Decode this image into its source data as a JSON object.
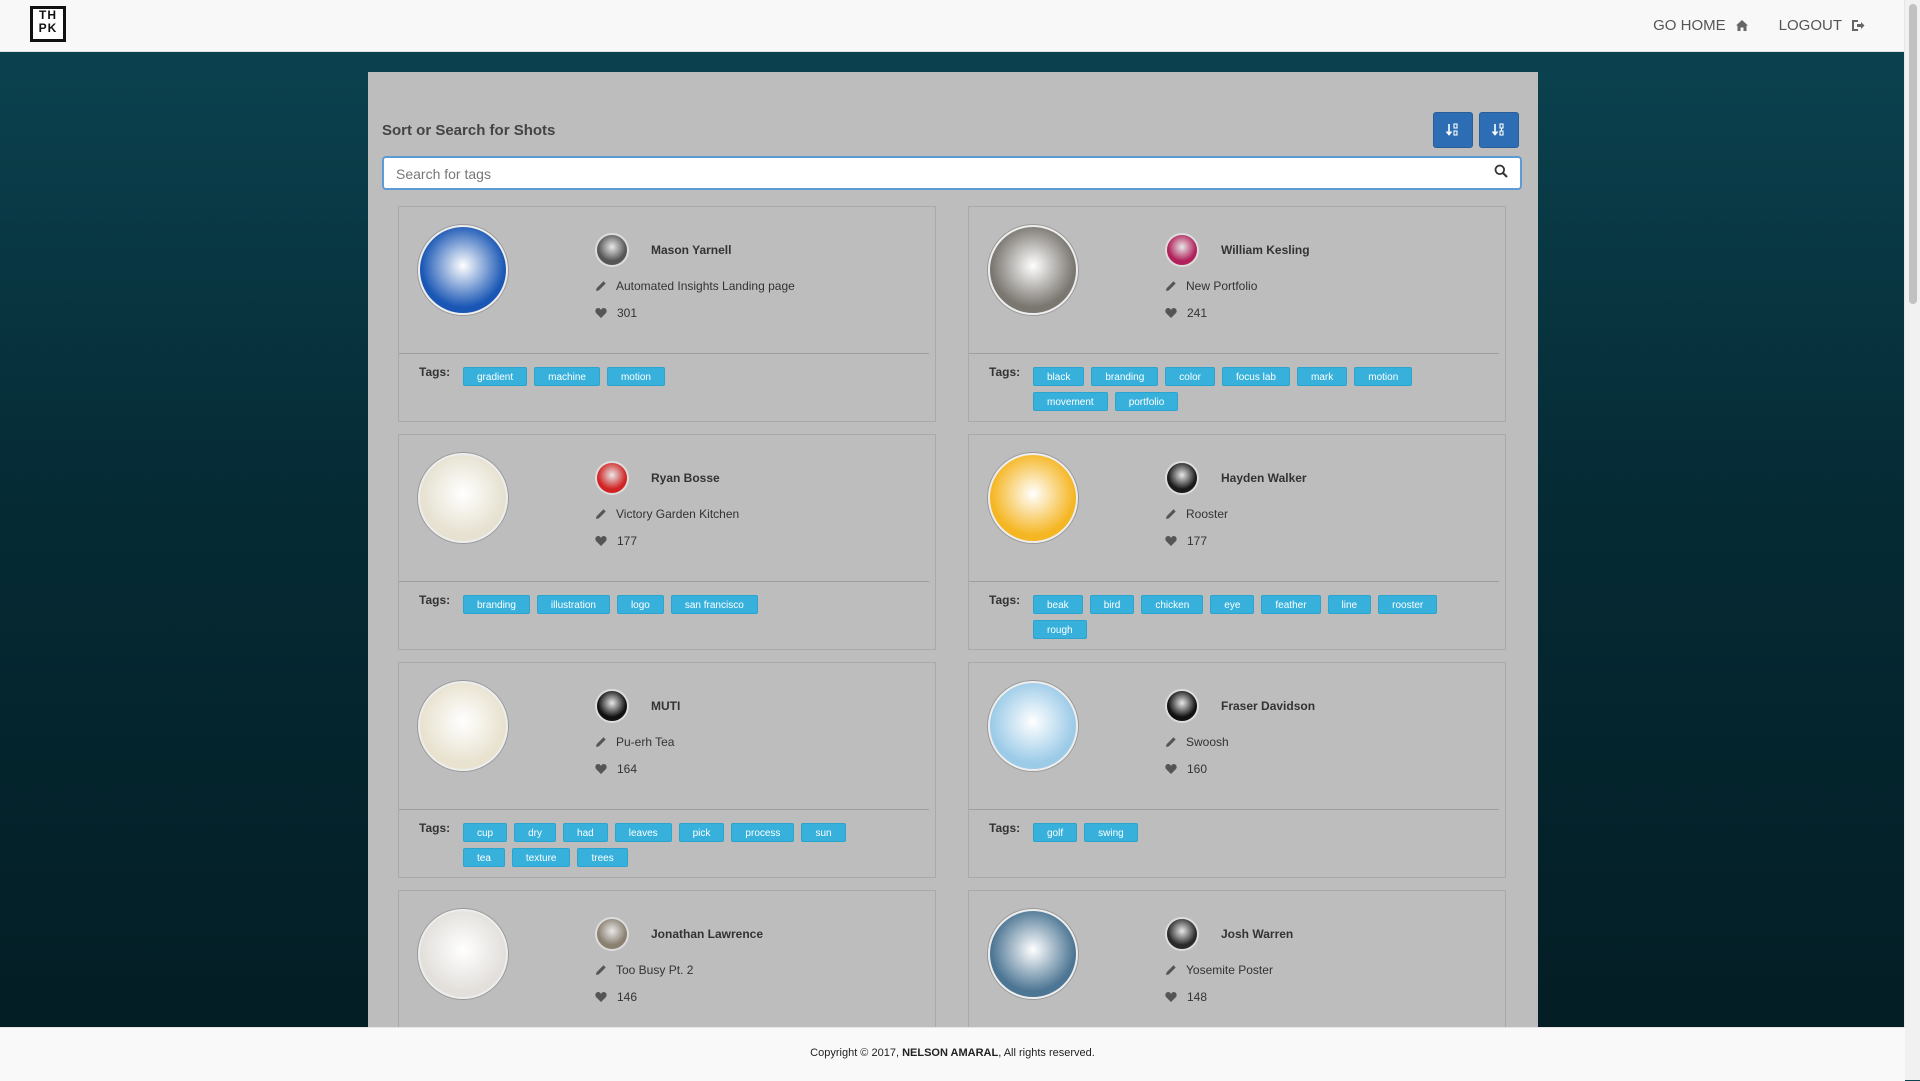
{
  "nav": {
    "logo_text": "THPK",
    "links": [
      {
        "label": "GO HOME",
        "icon": "home-icon"
      },
      {
        "label": "LOGOUT",
        "icon": "logout-icon"
      }
    ]
  },
  "panel": {
    "heading": "Sort or Search for Shots",
    "sort_buttons": [
      {
        "icon": "sort-ascending-icon"
      },
      {
        "icon": "sort-descending-icon"
      }
    ],
    "search": {
      "value": "",
      "placeholder": "Search for tags"
    },
    "tags_label": "Tags:"
  },
  "shots": [
    {
      "author": "Mason Yarnell",
      "title": "Automated Insights Landing page",
      "likes": "301",
      "tags": [
        "gradient",
        "machine",
        "motion"
      ],
      "thumb_color": "#1a57b5",
      "avatar_color": "#555"
    },
    {
      "author": "William Kesling",
      "title": "New Portfolio",
      "likes": "241",
      "tags": [
        "black",
        "branding",
        "color",
        "focus lab",
        "mark",
        "motion",
        "movement",
        "portfolio"
      ],
      "thumb_color": "#7a7670",
      "avatar_color": "#b0205a"
    },
    {
      "author": "Ryan Bosse",
      "title": "Victory Garden Kitchen",
      "likes": "177",
      "tags": [
        "branding",
        "illustration",
        "logo",
        "san francisco"
      ],
      "thumb_color": "#e6e1d0",
      "avatar_color": "#d02424"
    },
    {
      "author": "Hayden Walker",
      "title": "Rooster",
      "likes": "177",
      "tags": [
        "beak",
        "bird",
        "chicken",
        "eye",
        "feather",
        "line",
        "rooster",
        "rough"
      ],
      "thumb_color": "#f5b623",
      "avatar_color": "#1a1a1a"
    },
    {
      "author": "MUTI",
      "title": "Pu-erh Tea",
      "likes": "164",
      "tags": [
        "cup",
        "dry",
        "had",
        "leaves",
        "pick",
        "process",
        "sun",
        "tea",
        "texture",
        "trees"
      ],
      "thumb_color": "#e8e2cf",
      "avatar_color": "#111"
    },
    {
      "author": "Fraser Davidson",
      "title": "Swoosh",
      "likes": "160",
      "tags": [
        "golf",
        "swing"
      ],
      "thumb_color": "#9ccbe8",
      "avatar_color": "#111"
    },
    {
      "author": "Jonathan Lawrence",
      "title": "Too Busy Pt. 2",
      "likes": "146",
      "tags": [],
      "thumb_color": "#e3e0dc",
      "avatar_color": "#8a8070"
    },
    {
      "author": "Josh Warren",
      "title": "Yosemite Poster",
      "likes": "148",
      "tags": [],
      "thumb_color": "#4d7694",
      "avatar_color": "#2a2a2a"
    }
  ],
  "footer": {
    "prefix": "Copyright © 2017, ",
    "name": "NELSON AMARAL",
    "suffix": ", All rights reserved."
  }
}
